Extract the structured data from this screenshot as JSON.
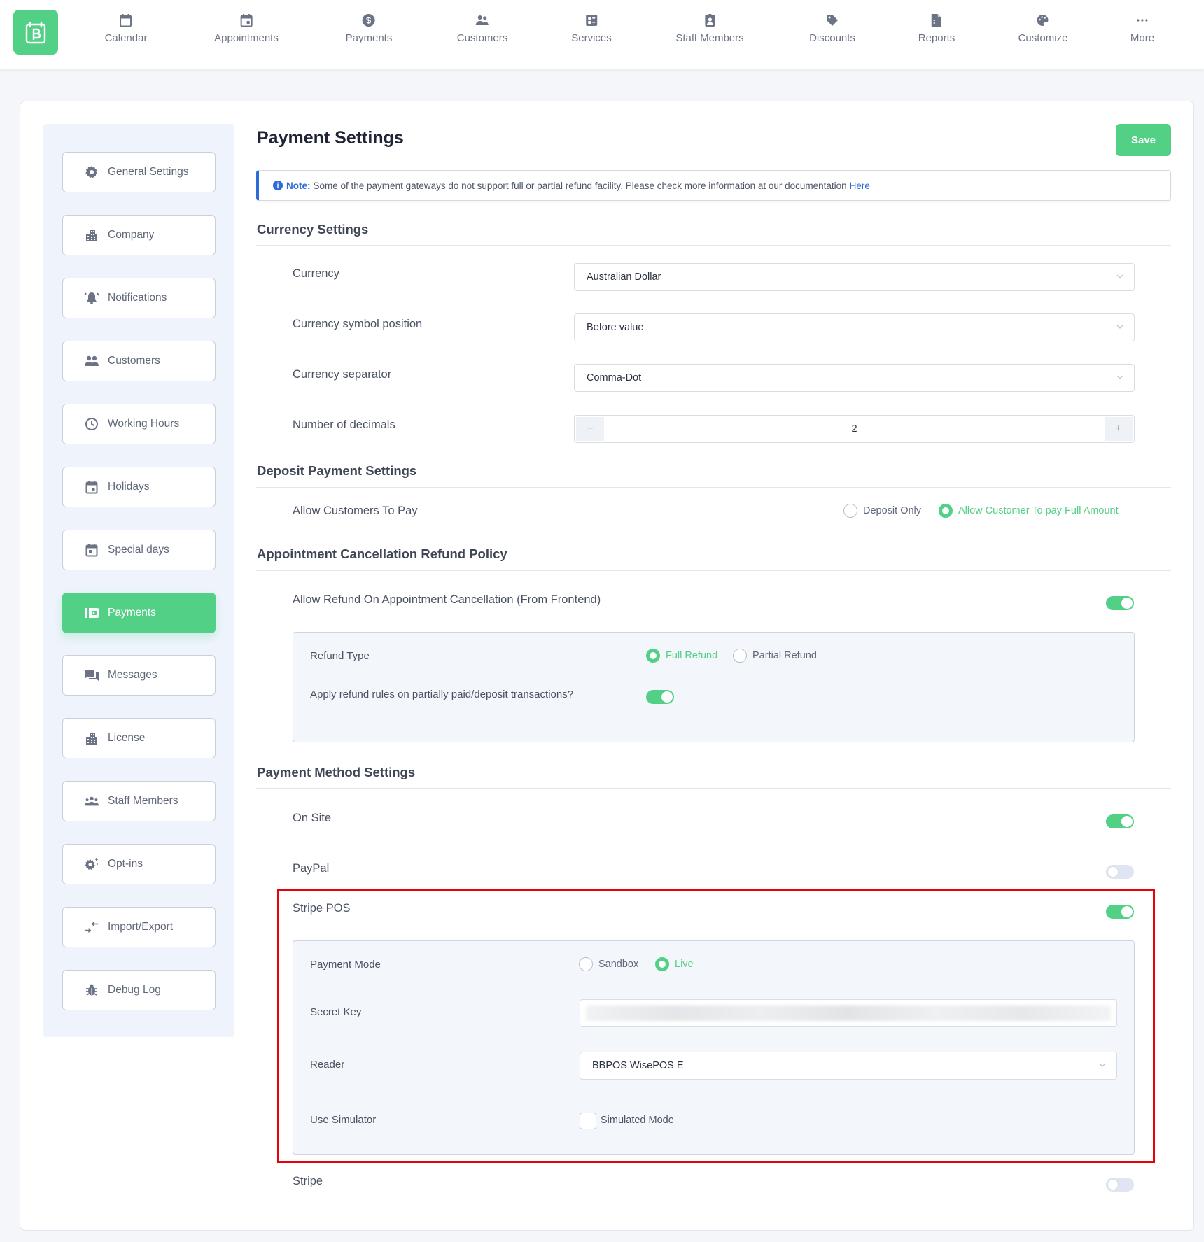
{
  "nav": {
    "items": [
      {
        "label": "Calendar",
        "icon": "calendar-icon"
      },
      {
        "label": "Appointments",
        "icon": "appointment-icon"
      },
      {
        "label": "Payments",
        "icon": "dollar-icon"
      },
      {
        "label": "Customers",
        "icon": "users-icon"
      },
      {
        "label": "Services",
        "icon": "services-icon"
      },
      {
        "label": "Staff Members",
        "icon": "badge-icon"
      },
      {
        "label": "Discounts",
        "icon": "tag-icon"
      },
      {
        "label": "Reports",
        "icon": "report-icon"
      },
      {
        "label": "Customize",
        "icon": "palette-icon"
      },
      {
        "label": "More",
        "icon": "ellipsis-icon"
      }
    ]
  },
  "sidebar": {
    "items": [
      {
        "label": "General Settings",
        "icon": "gear-icon",
        "active": false
      },
      {
        "label": "Company",
        "icon": "building-icon",
        "active": false
      },
      {
        "label": "Notifications",
        "icon": "bell-icon",
        "active": false
      },
      {
        "label": "Customers",
        "icon": "users-icon",
        "active": false
      },
      {
        "label": "Working Hours",
        "icon": "clock-icon",
        "active": false
      },
      {
        "label": "Holidays",
        "icon": "calendar-day-icon",
        "active": false
      },
      {
        "label": "Special days",
        "icon": "calendar-day-icon",
        "active": false
      },
      {
        "label": "Payments",
        "icon": "wallet-icon",
        "active": true
      },
      {
        "label": "Messages",
        "icon": "chat-icon",
        "active": false
      },
      {
        "label": "License",
        "icon": "building-icon",
        "active": false
      },
      {
        "label": "Staff Members",
        "icon": "team-icon",
        "active": false
      },
      {
        "label": "Opt-ins",
        "icon": "gear-sparkle-icon",
        "active": false
      },
      {
        "label": "Import/Export",
        "icon": "import-export-icon",
        "active": false
      },
      {
        "label": "Debug Log",
        "icon": "bug-icon",
        "active": false
      }
    ]
  },
  "page": {
    "title": "Payment Settings",
    "save_label": "Save",
    "note": {
      "strong": "Note:",
      "text": "Some of the payment gateways do not support full or partial refund facility. Please check more information at our documentation",
      "link": "Here"
    }
  },
  "currency": {
    "heading": "Currency Settings",
    "currency_label": "Currency",
    "currency_value": "Australian Dollar",
    "symbol_label": "Currency symbol position",
    "symbol_value": "Before value",
    "separator_label": "Currency separator",
    "separator_value": "Comma-Dot",
    "decimals_label": "Number of decimals",
    "decimals_value": "2",
    "minus": "−",
    "plus": "+"
  },
  "deposit": {
    "heading": "Deposit Payment Settings",
    "allow_label": "Allow Customers To Pay",
    "options": [
      {
        "label": "Deposit Only",
        "selected": false
      },
      {
        "label": "Allow Customer To pay Full Amount",
        "selected": true
      }
    ]
  },
  "refund": {
    "heading": "Appointment Cancellation Refund Policy",
    "allow_label": "Allow Refund On Appointment Cancellation (From Frontend)",
    "allow_enabled": true,
    "type_label": "Refund Type",
    "type_options": [
      {
        "label": "Full Refund",
        "selected": true
      },
      {
        "label": "Partial Refund",
        "selected": false
      }
    ],
    "apply_label": "Apply refund rules on partially paid/deposit transactions?",
    "apply_enabled": true
  },
  "methods": {
    "heading": "Payment Method Settings",
    "onsite": {
      "label": "On Site",
      "enabled": true
    },
    "paypal": {
      "label": "PayPal",
      "enabled": false
    },
    "stripe_pos": {
      "label": "Stripe POS",
      "enabled": true,
      "mode_label": "Payment Mode",
      "mode_options": [
        {
          "label": "Sandbox",
          "selected": false
        },
        {
          "label": "Live",
          "selected": true
        }
      ],
      "secret_label": "Secret Key",
      "reader_label": "Reader",
      "reader_value": "BBPOS WisePOS E",
      "simulator_label": "Use Simulator",
      "simulator_checkbox": "Simulated Mode",
      "simulator_checked": false
    },
    "stripe": {
      "label": "Stripe",
      "enabled": false
    }
  },
  "colors": {
    "accent": "#52d086",
    "link": "#2d6bd6",
    "highlight": "#e8000b"
  }
}
